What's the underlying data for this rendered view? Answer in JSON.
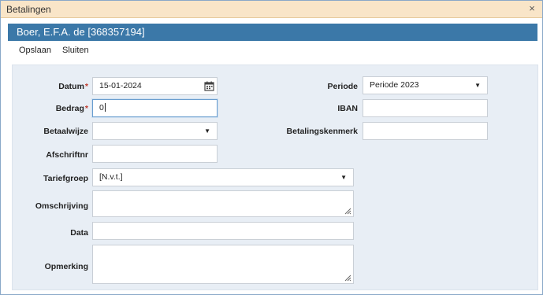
{
  "window": {
    "title": "Betalingen",
    "close_symbol": "×"
  },
  "header": {
    "name": "Boer, E.F.A. de [368357194]"
  },
  "toolbar": {
    "save_label": "Opslaan",
    "close_label": "Sluiten"
  },
  "form": {
    "datum": {
      "label": "Datum",
      "required_mark": "*",
      "value": "15-01-2024"
    },
    "bedrag": {
      "label": "Bedrag",
      "required_mark": "*",
      "value": "0"
    },
    "betaalwijze": {
      "label": "Betaalwijze",
      "value": ""
    },
    "afschriftnr": {
      "label": "Afschriftnr",
      "value": ""
    },
    "tariefgroep": {
      "label": "Tariefgroep",
      "value": "[N.v.t.]"
    },
    "omschrijving": {
      "label": "Omschrijving",
      "value": ""
    },
    "data": {
      "label": "Data",
      "value": ""
    },
    "opmerking": {
      "label": "Opmerking",
      "value": ""
    },
    "periode": {
      "label": "Periode",
      "value": "Periode 2023"
    },
    "iban": {
      "label": "IBAN",
      "value": ""
    },
    "betalingskenmerk": {
      "label": "Betalingskenmerk",
      "value": ""
    }
  },
  "icons": {
    "dropdown": "chevron-down-icon",
    "calendar": "calendar-icon",
    "resize": "resize-grip-icon",
    "close": "close-icon"
  },
  "colors": {
    "titlebar_bg": "#f9e5c8",
    "header_bg": "#3b78a8",
    "panel_bg": "#e8eef5",
    "required": "#c0392b"
  }
}
